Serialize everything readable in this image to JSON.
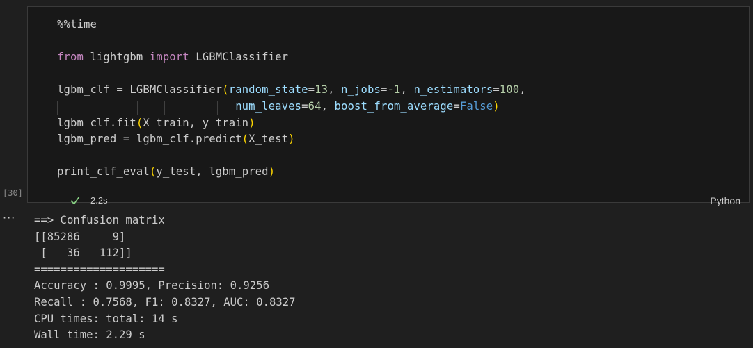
{
  "cell": {
    "execution_count": "[30]",
    "status_icon": "check-icon",
    "duration": "2.2s",
    "language": "Python",
    "code_lines": [
      [
        {
          "t": "%%time",
          "c": "plain"
        }
      ],
      [],
      [
        {
          "t": "from",
          "c": "kw"
        },
        {
          "t": " lightgbm ",
          "c": "plain"
        },
        {
          "t": "import",
          "c": "kw"
        },
        {
          "t": " LGBMClassifier",
          "c": "plain"
        }
      ],
      [],
      [
        {
          "t": "lgbm_clf = LGBMClassifier",
          "c": "plain"
        },
        {
          "t": "(",
          "c": "par"
        },
        {
          "t": "random_state",
          "c": "var"
        },
        {
          "t": "=",
          "c": "plain"
        },
        {
          "t": "13",
          "c": "num"
        },
        {
          "t": ", ",
          "c": "plain"
        },
        {
          "t": "n_jobs",
          "c": "var"
        },
        {
          "t": "=",
          "c": "plain"
        },
        {
          "t": "-1",
          "c": "num"
        },
        {
          "t": ", ",
          "c": "plain"
        },
        {
          "t": "n_estimators",
          "c": "var"
        },
        {
          "t": "=",
          "c": "plain"
        },
        {
          "t": "100",
          "c": "num"
        },
        {
          "t": ",",
          "c": "plain"
        }
      ],
      [
        {
          "t": "                           ",
          "c": "plain",
          "guides": true
        },
        {
          "t": "num_leaves",
          "c": "var"
        },
        {
          "t": "=",
          "c": "plain"
        },
        {
          "t": "64",
          "c": "num"
        },
        {
          "t": ", ",
          "c": "plain"
        },
        {
          "t": "boost_from_average",
          "c": "var"
        },
        {
          "t": "=",
          "c": "plain"
        },
        {
          "t": "False",
          "c": "const"
        },
        {
          "t": ")",
          "c": "par"
        }
      ],
      [
        {
          "t": "lgbm_clf.fit",
          "c": "plain"
        },
        {
          "t": "(",
          "c": "par"
        },
        {
          "t": "X_train, y_train",
          "c": "plain"
        },
        {
          "t": ")",
          "c": "par"
        }
      ],
      [
        {
          "t": "lgbm_pred = lgbm_clf.predict",
          "c": "plain"
        },
        {
          "t": "(",
          "c": "par"
        },
        {
          "t": "X_test",
          "c": "plain"
        },
        {
          "t": ")",
          "c": "par"
        }
      ],
      [],
      [
        {
          "t": "print_clf_eval",
          "c": "plain"
        },
        {
          "t": "(",
          "c": "par"
        },
        {
          "t": "y_test, lgbm_pred",
          "c": "plain"
        },
        {
          "t": ")",
          "c": "par"
        }
      ]
    ]
  },
  "output": {
    "menu_label": "···",
    "lines": [
      "==> Confusion matrix",
      "[[85286     9]",
      " [   36   112]]",
      "====================",
      "Accuracy : 0.9995, Precision: 0.9256",
      "Recall : 0.7568, F1: 0.8327, AUC: 0.8327",
      "CPU times: total: 14 s",
      "Wall time: 2.29 s"
    ]
  }
}
